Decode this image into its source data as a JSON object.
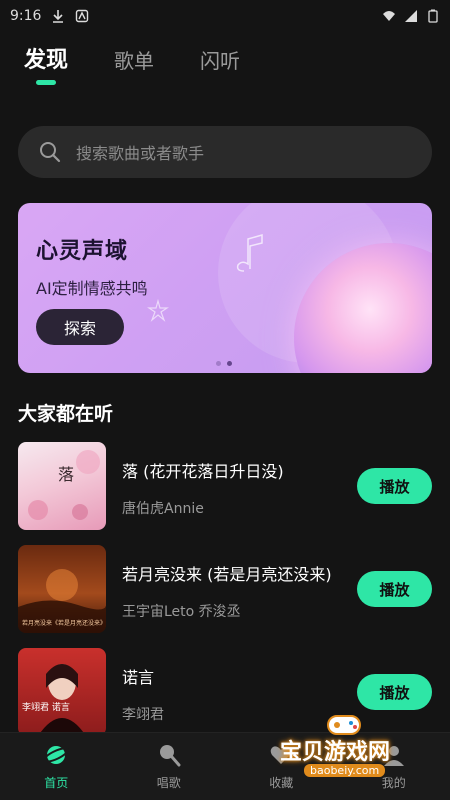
{
  "status_bar": {
    "time": "9:16"
  },
  "tabs": [
    {
      "label": "发现"
    },
    {
      "label": "歌单"
    },
    {
      "label": "闪听"
    }
  ],
  "search": {
    "placeholder": "搜索歌曲或者歌手"
  },
  "banner": {
    "title": "心灵声域",
    "subtitle": "AI定制情感共鸣",
    "button": "探索",
    "pager": {
      "total": 2,
      "active": 2
    }
  },
  "section": {
    "title": "大家都在听"
  },
  "songs": [
    {
      "title": "落 (花开花落日升日没)",
      "artist": "唐伯虎Annie",
      "button": "播放",
      "cover_text": "落"
    },
    {
      "title": "若月亮没来 (若是月亮还没来)",
      "artist": "王宇宙Leto 乔浚丞",
      "button": "播放",
      "cover_text": "若月亮没来《若是月亮还没来》"
    },
    {
      "title": "诺言",
      "artist": "李翊君",
      "button": "播放",
      "cover_text": "李翊君 诺言"
    }
  ],
  "nav": [
    {
      "label": "首页",
      "icon": "planet-icon"
    },
    {
      "label": "唱歌",
      "icon": "microphone-icon"
    },
    {
      "label": "收藏",
      "icon": "heart-icon"
    },
    {
      "label": "我的",
      "icon": "user-icon"
    }
  ],
  "watermark": {
    "text": "宝贝游戏网",
    "url": "baobeiy.com"
  },
  "colors": {
    "accent": "#2ee6a6",
    "background": "#141414",
    "banner": "#d4a3f3"
  }
}
